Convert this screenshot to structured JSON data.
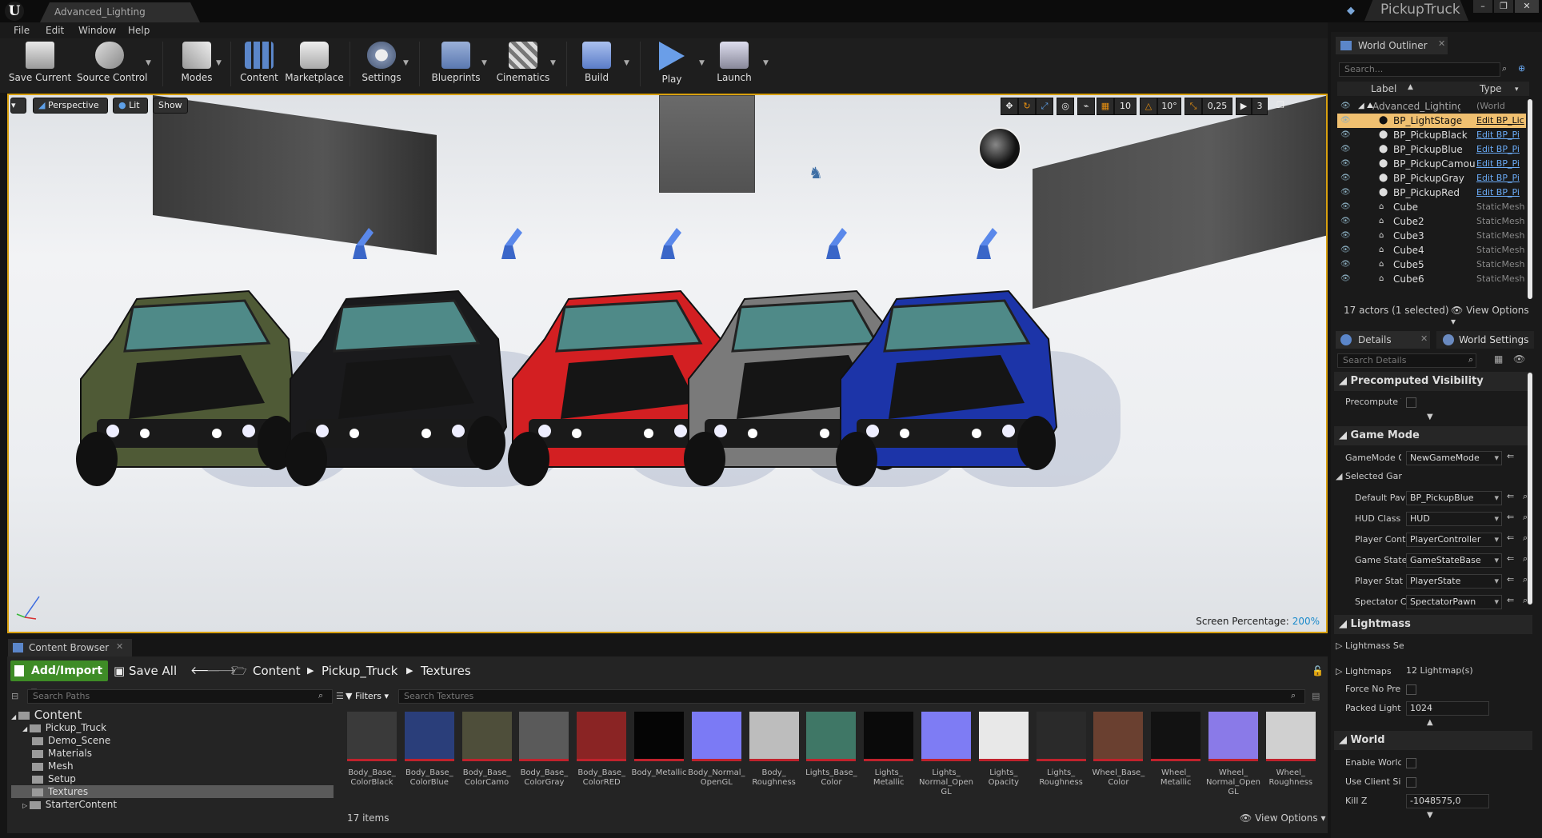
{
  "title_bar": {
    "document_tab": "Advanced_Lighting",
    "project_name": "PickupTruck"
  },
  "menu": [
    "File",
    "Edit",
    "Window",
    "Help"
  ],
  "toolbar": [
    {
      "label": "Save Current",
      "icon": "save-icon"
    },
    {
      "label": "Source Control",
      "icon": "source-control-icon"
    },
    {
      "label": "Modes",
      "icon": "modes-icon"
    },
    {
      "label": "Content",
      "icon": "content-icon"
    },
    {
      "label": "Marketplace",
      "icon": "marketplace-icon"
    },
    {
      "label": "Settings",
      "icon": "settings-icon"
    },
    {
      "label": "Blueprints",
      "icon": "blueprints-icon"
    },
    {
      "label": "Cinematics",
      "icon": "cinematics-icon"
    },
    {
      "label": "Build",
      "icon": "build-icon"
    },
    {
      "label": "Play",
      "icon": "play-icon"
    },
    {
      "label": "Launch",
      "icon": "launch-icon"
    }
  ],
  "viewport": {
    "view_mode": "Perspective",
    "lighting": "Lit",
    "show": "Show",
    "grid_snap": "10",
    "rotation_snap": "10°",
    "scale_snap": "0,25",
    "camera_speed": "3",
    "screen_percentage_label": "Screen Percentage:",
    "screen_percentage_value": "200%",
    "trucks": [
      {
        "color": "camo",
        "body": "#4f5a36"
      },
      {
        "color": "black",
        "body": "#1a1a1c"
      },
      {
        "color": "red",
        "body": "#d31f22"
      },
      {
        "color": "gray",
        "body": "#7a7a7a"
      },
      {
        "color": "blue",
        "body": "#1c34a8"
      }
    ],
    "accent_color": "#d8a010"
  },
  "content_browser": {
    "tab_title": "Content Browser",
    "add_import": "Add/Import",
    "save_all": "Save All",
    "breadcrumb": [
      "Content",
      "Pickup_Truck",
      "Textures"
    ],
    "search_paths_placeholder": "Search Paths",
    "filters_label": "Filters",
    "search_textures_placeholder": "Search Textures",
    "tree": [
      {
        "label": "Content",
        "level": 0
      },
      {
        "label": "Pickup_Truck",
        "level": 1
      },
      {
        "label": "Demo_Scene",
        "level": 2
      },
      {
        "label": "Materials",
        "level": 2
      },
      {
        "label": "Mesh",
        "level": 2
      },
      {
        "label": "Setup",
        "level": 2
      },
      {
        "label": "Textures",
        "level": 2,
        "selected": true
      },
      {
        "label": "StarterContent",
        "level": 1
      }
    ],
    "assets": [
      {
        "label": "Body_Base_ ColorBlack",
        "color": "#3a3a3a"
      },
      {
        "label": "Body_Base_ ColorBlue",
        "color": "#2a3e7a"
      },
      {
        "label": "Body_Base_ ColorCamo",
        "color": "#4e4e3a"
      },
      {
        "label": "Body_Base_ ColorGray",
        "color": "#5a5a5a"
      },
      {
        "label": "Body_Base_ ColorRED",
        "color": "#8a2424"
      },
      {
        "label": "Body_Metallic",
        "color": "#050505"
      },
      {
        "label": "Body_Normal_ OpenGL",
        "color": "#7b7af5"
      },
      {
        "label": "Body_ Roughness",
        "color": "#bdbdbd"
      },
      {
        "label": "Lights_Base_ Color",
        "color": "#3f7766"
      },
      {
        "label": "Lights_ Metallic",
        "color": "#0a0a0a"
      },
      {
        "label": "Lights_ Normal_Open GL",
        "color": "#7e7cf4"
      },
      {
        "label": "Lights_ Opacity",
        "color": "#e8e8e8"
      },
      {
        "label": "Lights_ Roughness",
        "color": "#2a2a2a"
      },
      {
        "label": "Wheel_Base_ Color",
        "color": "#6a4030"
      },
      {
        "label": "Wheel_ Metallic",
        "color": "#121212"
      },
      {
        "label": "Wheel_ Normal_Open GL",
        "color": "#8a7ae8"
      },
      {
        "label": "Wheel_ Roughness",
        "color": "#d0d0d0"
      }
    ],
    "items_count": "17 items",
    "view_options": "View Options"
  },
  "world_outliner": {
    "tab_title": "World Outliner",
    "search_placeholder": "Search...",
    "col_label": "Label",
    "col_type": "Type",
    "rows": [
      {
        "label": "Advanced_Lighting",
        "type": "(World",
        "link": false
      },
      {
        "label": "BP_LightStage",
        "type": "Edit BP_Lic",
        "link": true,
        "selected": true
      },
      {
        "label": "BP_PickupBlack",
        "type": "Edit BP_Pi",
        "link": true
      },
      {
        "label": "BP_PickupBlue",
        "type": "Edit BP_Pi",
        "link": true
      },
      {
        "label": "BP_PickupCamou",
        "type": "Edit BP_Pi",
        "link": true
      },
      {
        "label": "BP_PickupGray",
        "type": "Edit BP_Pi",
        "link": true
      },
      {
        "label": "BP_PickupRed",
        "type": "Edit BP_Pi",
        "link": true
      },
      {
        "label": "Cube",
        "type": "StaticMesh",
        "link": false
      },
      {
        "label": "Cube2",
        "type": "StaticMesh",
        "link": false
      },
      {
        "label": "Cube3",
        "type": "StaticMesh",
        "link": false
      },
      {
        "label": "Cube4",
        "type": "StaticMesh",
        "link": false
      },
      {
        "label": "Cube5",
        "type": "StaticMesh",
        "link": false
      },
      {
        "label": "Cube6",
        "type": "StaticMesh",
        "link": false
      }
    ],
    "footer": "17 actors (1 selected)",
    "view_options": "View Options"
  },
  "details": {
    "details_tab": "Details",
    "world_settings_tab": "World Settings",
    "search_placeholder": "Search Details",
    "precomputed_visibility": "Precomputed Visibility",
    "precompute_label": "Precompute V",
    "game_mode": "Game Mode",
    "gamemode_override": {
      "label": "GameMode O",
      "value": "NewGameMode"
    },
    "selected_gamemode": "Selected Gar",
    "default_pawn": {
      "label": "Default Pav",
      "value": "BP_PickupBlue"
    },
    "hud_class": {
      "label": "HUD Class",
      "value": "HUD"
    },
    "player_controller": {
      "label": "Player Cont",
      "value": "PlayerController"
    },
    "game_state": {
      "label": "Game State",
      "value": "GameStateBase"
    },
    "player_state": {
      "label": "Player Stat",
      "value": "PlayerState"
    },
    "spectator": {
      "label": "Spectator C",
      "value": "SpectatorPawn"
    },
    "lightmass": "Lightmass",
    "lightmass_settings": "Lightmass Se",
    "lightmaps": {
      "label": "Lightmaps",
      "value": "12 Lightmap(s)"
    },
    "force_no_precomputed": "Force No Prec",
    "packed_light": {
      "label": "Packed Light",
      "value": "1024"
    },
    "world": "World",
    "enable_world": "Enable World",
    "use_client_side": "Use Client Sic",
    "kill_z": {
      "label": "Kill Z",
      "value": "-1048575,0"
    }
  }
}
